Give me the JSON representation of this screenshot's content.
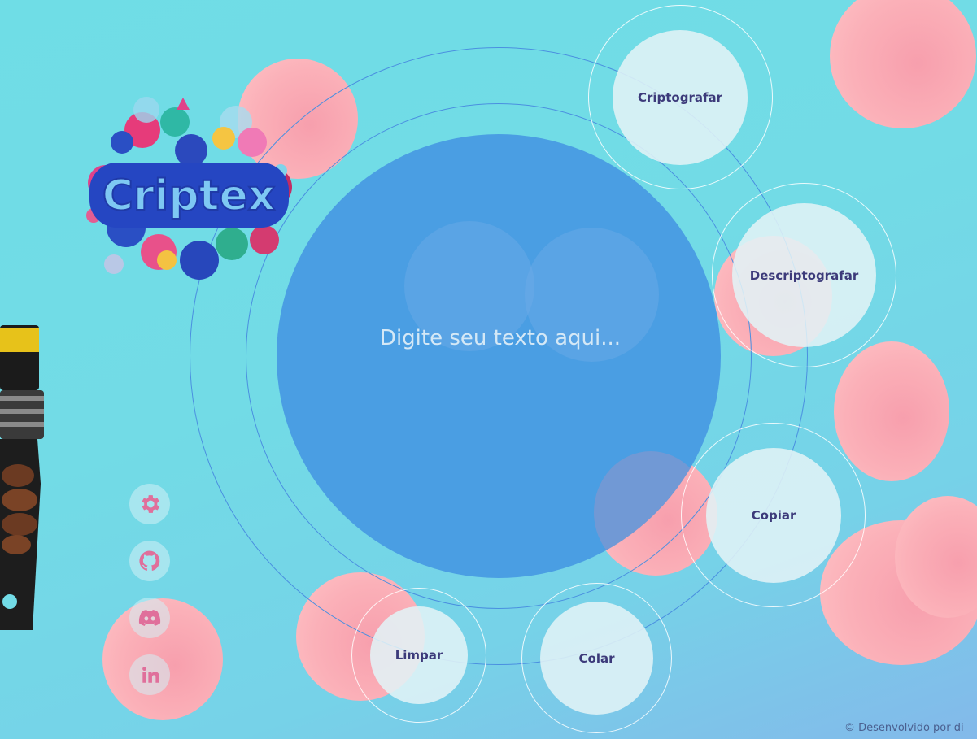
{
  "app": {
    "logo_text": "Criptex"
  },
  "input": {
    "placeholder": "Digite seu texto aqui..."
  },
  "buttons": {
    "encrypt": "Criptografar",
    "decrypt": "Descriptografar",
    "copy": "Copiar",
    "paste": "Colar",
    "clear": "Limpar"
  },
  "social": {
    "settings_icon": "gear-icon",
    "github_icon": "github-icon",
    "discord_icon": "discord-icon",
    "linkedin_icon": "linkedin-icon"
  },
  "footer": {
    "text": "© Desenvolvido por di"
  },
  "colors": {
    "main_circle": "#4a9ee3",
    "button_text": "#3c3a7a",
    "blob": "#f79fad"
  }
}
